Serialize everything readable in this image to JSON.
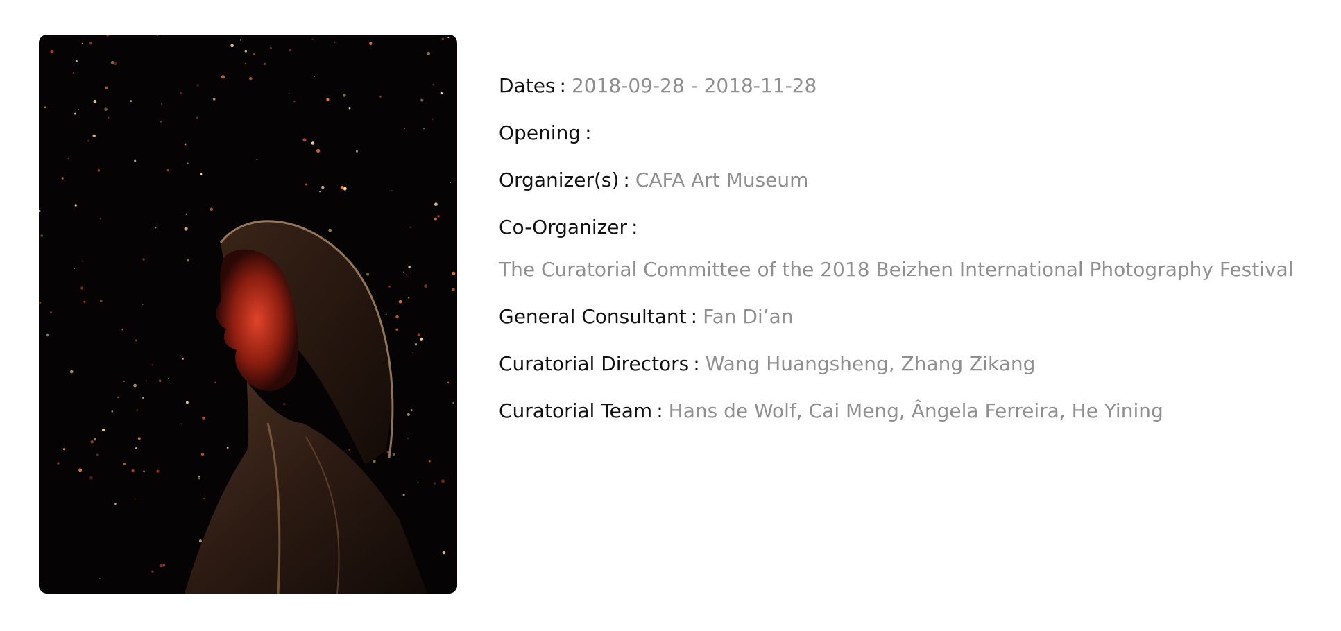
{
  "poster": {
    "alt": "Hooded figure in orange light against a dark starry background"
  },
  "details": {
    "separator": ":",
    "dates": {
      "label": "Dates",
      "value": "2018-09-28 - 2018-11-28"
    },
    "opening": {
      "label": "Opening",
      "value": ""
    },
    "organizers": {
      "label": "Organizer(s)",
      "value": "CAFA Art Museum"
    },
    "co_organizer": {
      "label": "Co-Organizer",
      "value": "The Curatorial Committee of the 2018 Beizhen International Photography Festival"
    },
    "general_consultant": {
      "label": "General Consultant",
      "value": "Fan Di’an"
    },
    "curatorial_directors": {
      "label": "Curatorial Directors",
      "value": "Wang Huangsheng, Zhang Zikang"
    },
    "curatorial_team": {
      "label": "Curatorial Team",
      "value": "Hans de Wolf, Cai Meng, Ângela Ferreira, He Yining"
    }
  },
  "colors": {
    "label": "#111111",
    "value": "#8f8f8f",
    "background": "#ffffff"
  }
}
